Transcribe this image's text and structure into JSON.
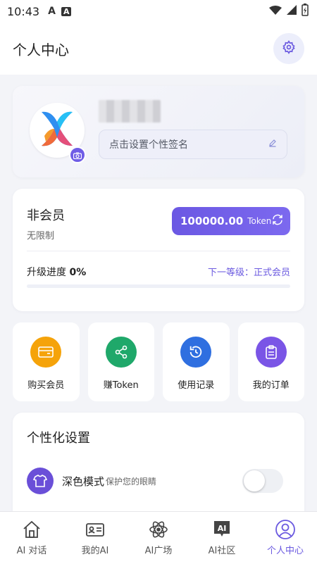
{
  "status_bar": {
    "time": "10:43",
    "icons": [
      "A",
      "A"
    ]
  },
  "header": {
    "title": "个人中心"
  },
  "profile": {
    "signature_placeholder": "点击设置个性签名"
  },
  "membership": {
    "level": "非会员",
    "subtitle": "无限制",
    "token_value": "100000.00",
    "token_unit": "Token",
    "progress_label": "升级进度",
    "progress_value": "0%",
    "progress_fraction": 0,
    "next_level": "下一等级：正式会员"
  },
  "tiles": [
    {
      "label": "购买会员",
      "color": "#f5a30a",
      "icon": "card-icon"
    },
    {
      "label": "赚Token",
      "color": "#1fa86a",
      "icon": "share-icon"
    },
    {
      "label": "使用记录",
      "color": "#2f6fe0",
      "icon": "history-icon"
    },
    {
      "label": "我的订单",
      "color": "#7a55e6",
      "icon": "clipboard-icon"
    }
  ],
  "settings": {
    "title": "个性化设置",
    "dark_mode": {
      "name": "深色模式",
      "desc": "保护您的眼睛",
      "enabled": false
    }
  },
  "tabs": [
    {
      "label": "AI 对话",
      "icon": "home-icon",
      "active": false
    },
    {
      "label": "我的AI",
      "icon": "id-card-icon",
      "active": false
    },
    {
      "label": "AI广场",
      "icon": "atom-icon",
      "active": false
    },
    {
      "label": "AI社区",
      "icon": "ai-chat-icon",
      "active": false
    },
    {
      "label": "个人中心",
      "icon": "user-icon",
      "active": true
    }
  ],
  "colors": {
    "accent": "#6b5ae0",
    "background": "#f3f4f8"
  }
}
